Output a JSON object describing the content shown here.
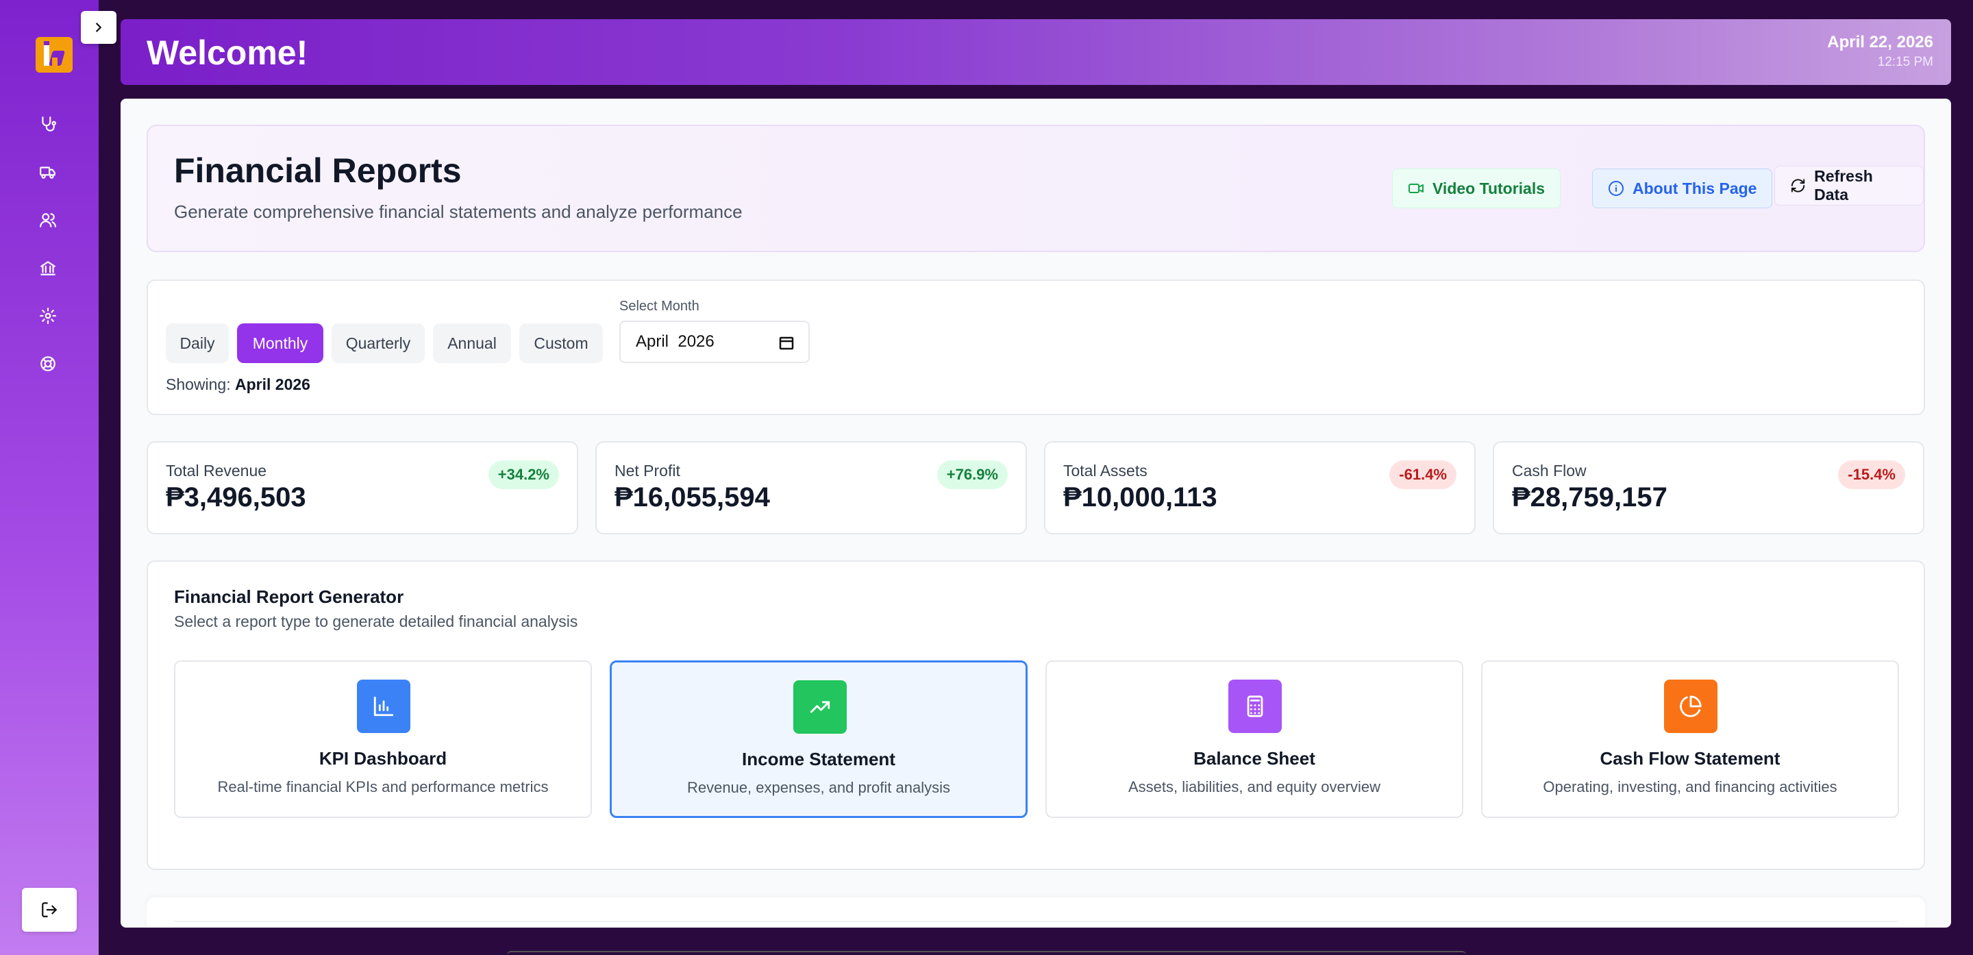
{
  "header": {
    "welcome": "Welcome!",
    "date": "April 22, 2026",
    "time": "12:15 PM"
  },
  "sidebar": {
    "items": [
      {
        "icon": "stethoscope-icon"
      },
      {
        "icon": "truck-icon"
      },
      {
        "icon": "users-icon"
      },
      {
        "icon": "bank-icon"
      },
      {
        "icon": "gear-icon"
      },
      {
        "icon": "lifebuoy-icon"
      }
    ],
    "logout_icon": "logout-icon"
  },
  "page": {
    "title": "Financial Reports",
    "subtitle": "Generate comprehensive financial statements and analyze performance",
    "buttons": {
      "video": "Video Tutorials",
      "about": "About This Page",
      "refresh": "Refresh Data"
    }
  },
  "filter": {
    "periods": [
      "Daily",
      "Monthly",
      "Quarterly",
      "Annual",
      "Custom"
    ],
    "active": "Monthly",
    "select_label": "Select Month",
    "month_value": "April  2026",
    "showing_label": "Showing:",
    "showing_value": "April 2026"
  },
  "stats": [
    {
      "label": "Total Revenue",
      "value": "₱3,496,503",
      "change": "+34.2%",
      "trend": "positive"
    },
    {
      "label": "Net Profit",
      "value": "₱16,055,594",
      "change": "+76.9%",
      "trend": "positive"
    },
    {
      "label": "Total Assets",
      "value": "₱10,000,113",
      "change": "-61.4%",
      "trend": "negative"
    },
    {
      "label": "Cash Flow",
      "value": "₱28,759,157",
      "change": "-15.4%",
      "trend": "negative"
    }
  ],
  "generator": {
    "title": "Financial Report Generator",
    "subtitle": "Select a report type to generate detailed financial analysis",
    "reports": [
      {
        "title": "KPI Dashboard",
        "desc": "Real-time financial KPIs and performance metrics",
        "color": "#3b82f6",
        "icon": "bar-chart-icon"
      },
      {
        "title": "Income Statement",
        "desc": "Revenue, expenses, and profit analysis",
        "color": "#22c55e",
        "icon": "trending-up-icon",
        "selected": true
      },
      {
        "title": "Balance Sheet",
        "desc": "Assets, liabilities, and equity overview",
        "color": "#a855f7",
        "icon": "calculator-icon"
      },
      {
        "title": "Cash Flow Statement",
        "desc": "Operating, investing, and financing activities",
        "color": "#f97316",
        "icon": "pie-chart-icon"
      }
    ]
  },
  "colors": {
    "brand": "#9333ea",
    "positive": "#15803d",
    "negative": "#b91c1c",
    "info": "#2563eb"
  }
}
